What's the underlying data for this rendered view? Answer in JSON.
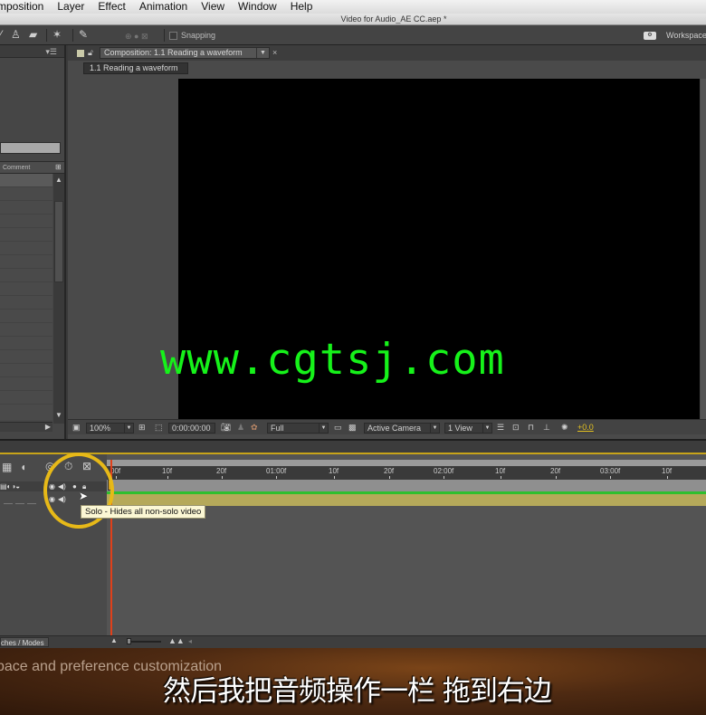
{
  "menubar": {
    "items": [
      "mposition",
      "Layer",
      "Effect",
      "Animation",
      "View",
      "Window",
      "Help"
    ]
  },
  "window": {
    "title": "Video for Audio_AE CC.aep *"
  },
  "toolbar": {
    "snapping_label": "Snapping",
    "snapping_checked": false,
    "workspace_label": "Workspace"
  },
  "project_panel": {
    "column_header": "Comment"
  },
  "composition_panel": {
    "tab_label": "Composition: 1.1 Reading a waveform",
    "breadcrumb": "1.1 Reading a waveform",
    "watermark": "www.cgtsj.com",
    "bottom_bar": {
      "magnification": "100%",
      "timecode": "0:00:00:00",
      "resolution": "Full",
      "view": "Active Camera",
      "layout": "1 View",
      "exposure": "+0.0"
    }
  },
  "timeline": {
    "ruler_ticks": [
      "00f",
      "10f",
      "20f",
      "01:00f",
      "10f",
      "20f",
      "02:00f",
      "10f",
      "20f",
      "03:00f",
      "10f"
    ],
    "modes_label": "ches / Modes",
    "tooltip": "Solo - Hides all non-solo video"
  },
  "video_overlay": {
    "course_text": "pace and preference customization",
    "subtitle": "然后我把音频操作一栏 拖到右边"
  },
  "colors": {
    "highlight": "#e7b918",
    "watermark": "#16f21a",
    "playhead": "#e0401a",
    "exposure": "#e2c020"
  }
}
